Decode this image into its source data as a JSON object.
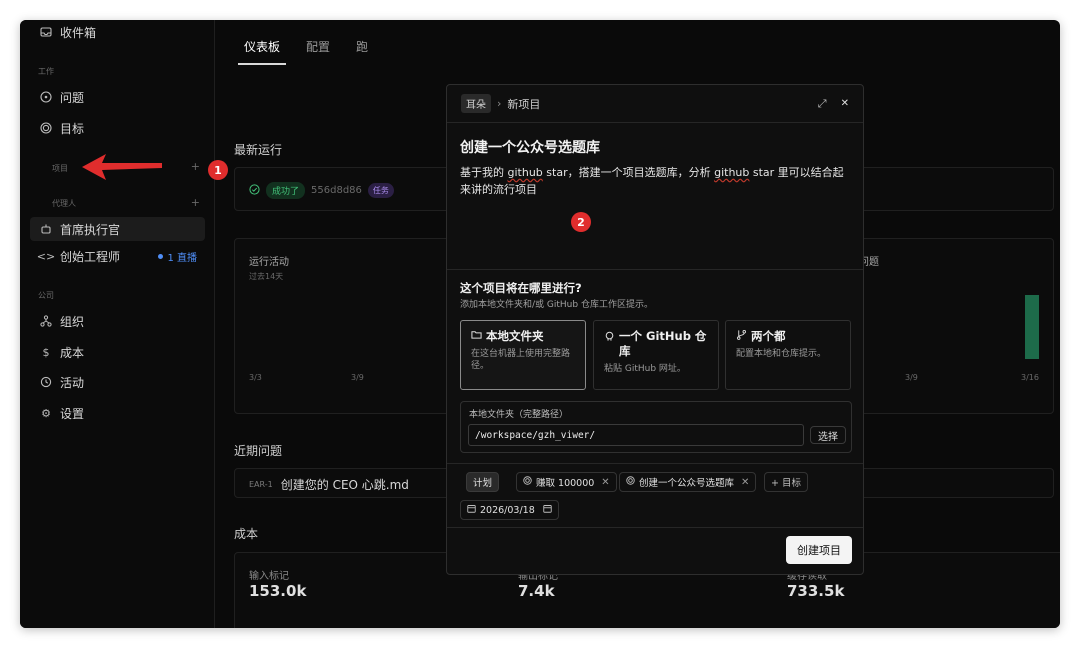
{
  "sidebar": {
    "inbox": "收件箱",
    "work_section": "工作",
    "issues": "问题",
    "goals": "目标",
    "projects_section": "项目",
    "agents_section": "代理人",
    "agents": [
      {
        "label": "首席执行官"
      },
      {
        "label": "创始工程师",
        "badge": "1 直播"
      }
    ],
    "company_section": "公司",
    "company_items": [
      "组织",
      "成本",
      "活动",
      "设置"
    ]
  },
  "main": {
    "tabs": [
      "仪表板",
      "配置",
      "跑"
    ],
    "latest_runs_title": "最新运行",
    "run": {
      "status": "成功了",
      "id": "556d8d86",
      "tag": "任务"
    },
    "activity_title": "运行活动",
    "activity_sub": "过去14天",
    "activity_ticks": [
      "3/3",
      "3/9"
    ],
    "right_title": "问题",
    "right_ticks": [
      "3/9",
      "3/16"
    ],
    "recent_issues_title": "近期问题",
    "issue": {
      "key": "EAR-1",
      "title": "创建您的 CEO 心跳.md"
    },
    "cost_title": "成本",
    "costs": [
      {
        "label": "输入标记",
        "value": "153.0k"
      },
      {
        "label": "输出标记",
        "value": "7.4k"
      },
      {
        "label": "缓存读取",
        "value": "733.5k"
      }
    ]
  },
  "modal": {
    "crumb_chip": "耳朵",
    "crumb_sep": "›",
    "crumb_title": "新项目",
    "expand_icon": "⤢",
    "close_icon": "✕",
    "title": "创建一个公众号选题库",
    "desc_parts": [
      "基于我的 ",
      "github",
      " star，搭建一个项目选题库，分析 ",
      "github",
      " star 里可以结合起来讲的流行项目"
    ],
    "where_title": "这个项目将在哪里进行?",
    "where_sub": "添加本地文件夹和/或 GitHub 仓库工作区提示。",
    "options": [
      {
        "title": "本地文件夹",
        "sub": "在这台机器上使用完整路径。",
        "selected": true
      },
      {
        "title": "一个 GitHub 仓库",
        "sub": "粘贴 GitHub 网址。",
        "selected": false
      },
      {
        "title": "两个都",
        "sub": "配置本地和仓库提示。",
        "selected": false
      }
    ],
    "folder_label": "本地文件夹（完整路径）",
    "folder_value": "/workspace/gzh_viwer/",
    "choose_label": "选择",
    "status_chip": "计划",
    "goal_chip_1": "赚取 100000",
    "goal_chip_2": "创建一个公众号选题库",
    "add_goal": "+ 目标",
    "date": "2026/03/18",
    "create_label": "创建项目"
  },
  "annotations": [
    "1",
    "2"
  ],
  "colors": {
    "accent_red": "#e02d2d",
    "success_green": "#43c27a",
    "chart_bar": "#1d6b4a"
  }
}
